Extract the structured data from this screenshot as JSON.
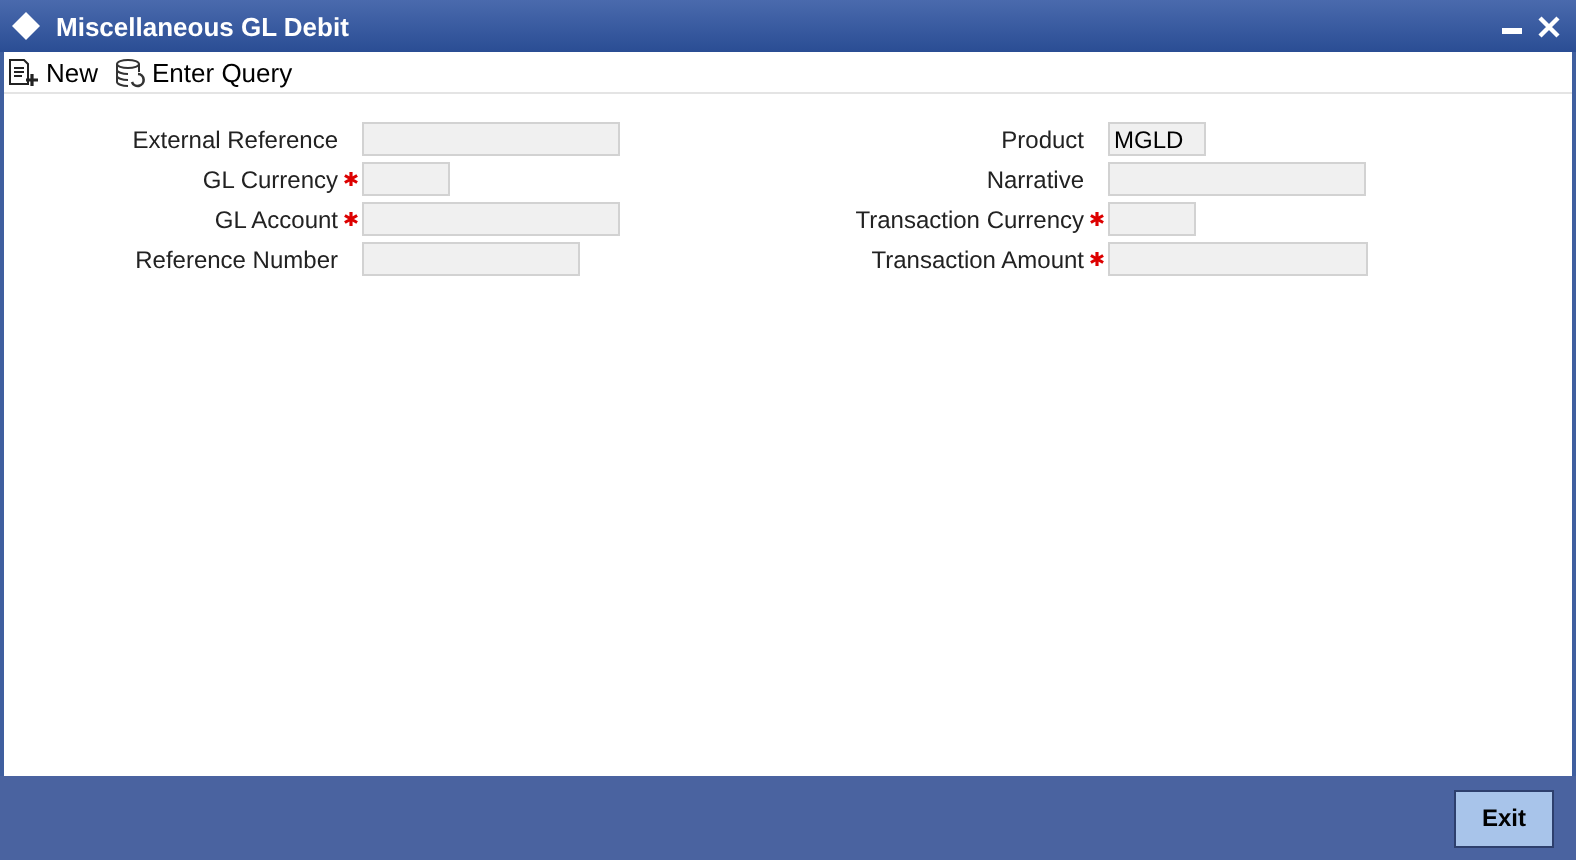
{
  "window": {
    "title": "Miscellaneous GL Debit"
  },
  "toolbar": [
    {
      "label": "New",
      "kind": "new"
    },
    {
      "label": "Enter Query",
      "kind": "query"
    }
  ],
  "left_fields": [
    {
      "label": "External Reference",
      "required": false
    },
    {
      "label": "GL Currency",
      "required": true
    },
    {
      "label": "GL Account",
      "required": true
    },
    {
      "label": "Reference Number",
      "required": false
    }
  ],
  "right_fields": [
    {
      "label": "Product",
      "required": false,
      "value": "MGLD"
    },
    {
      "label": "Narrative",
      "required": false
    },
    {
      "label": "Transaction Currency",
      "required": true
    },
    {
      "label": "Transaction Amount",
      "required": true
    }
  ],
  "footer": {
    "buttons": [
      "Exit"
    ]
  }
}
